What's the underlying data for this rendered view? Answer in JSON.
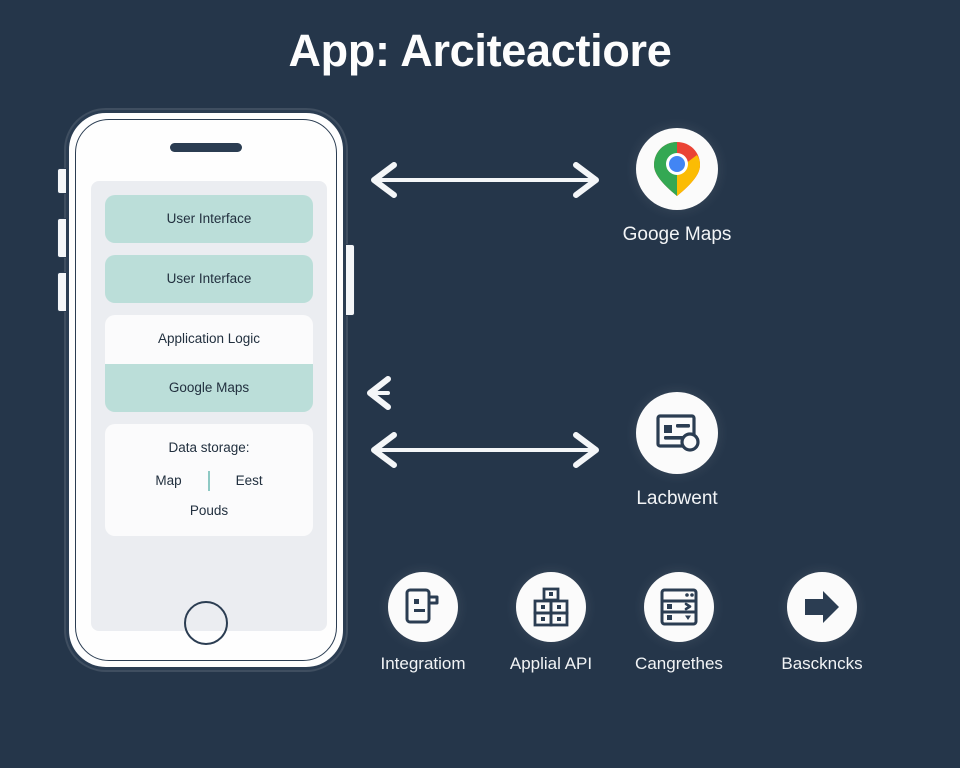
{
  "page": {
    "title": "App: Arciteactiore",
    "background_color": "#25364a",
    "accent_teal": "#bbded9",
    "text_light": "#f2f4f6",
    "text_dark": "#22303f"
  },
  "phone": {
    "screen": {
      "groups": [
        {
          "id": "ui-group",
          "rows": [
            {
              "label": "User Interface",
              "style": "teal"
            }
          ]
        },
        {
          "id": "ui-group-2",
          "rows": [
            {
              "label": "User Interface",
              "style": "teal"
            }
          ]
        },
        {
          "id": "logic-group",
          "rows": [
            {
              "label": "Application Logic",
              "style": "white"
            },
            {
              "label": "Google Maps",
              "style": "teal"
            }
          ]
        }
      ],
      "storage_card": {
        "title": "Data storage:",
        "left": "Map",
        "right": "Eest",
        "bottom": "Pouds"
      }
    }
  },
  "nodes": {
    "google_maps": {
      "label": "Googe Maps",
      "icon": "google-maps-pin-icon"
    },
    "lacbwent": {
      "label": "Lacbwent",
      "icon": "document-card-icon"
    },
    "bottom_row": [
      {
        "label": "Integratiom",
        "icon": "device-plug-icon"
      },
      {
        "label": "Applial API",
        "icon": "stacked-boxes-icon"
      },
      {
        "label": "Cangrethes",
        "icon": "server-rack-icon"
      },
      {
        "label": "Basckncks",
        "icon": "arrow-right-block-icon"
      }
    ]
  },
  "arrows": {
    "top": {
      "name": "bidirectional-arrow-top",
      "direction": "both"
    },
    "middle_small": {
      "name": "arrow-left-small",
      "direction": "left"
    },
    "bottom": {
      "name": "bidirectional-arrow-bottom",
      "direction": "both"
    }
  }
}
